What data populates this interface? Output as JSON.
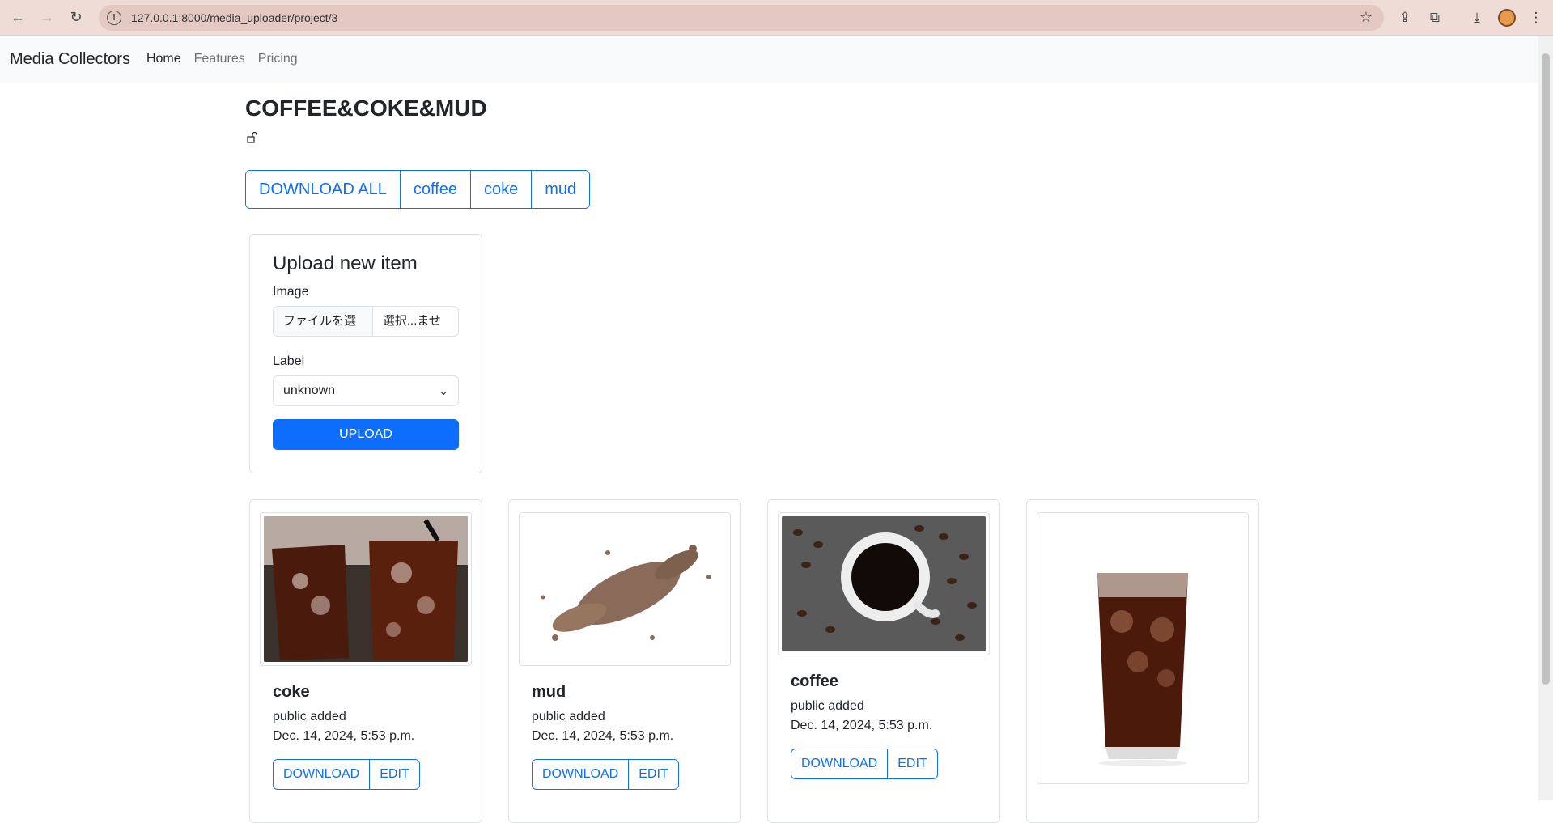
{
  "browser": {
    "url": "127.0.0.1:8000/media_uploader/project/3"
  },
  "navbar": {
    "brand": "Media Collectors",
    "links": [
      "Home",
      "Features",
      "Pricing"
    ]
  },
  "project": {
    "title": "COFFEE&COKE&MUD",
    "filters": [
      "DOWNLOAD ALL",
      "coffee",
      "coke",
      "mud"
    ]
  },
  "upload": {
    "title": "Upload new item",
    "image_label": "Image",
    "file_button": "ファイルを選択",
    "file_status": "選択...ません",
    "label_label": "Label",
    "label_value": "unknown",
    "submit": "UPLOAD"
  },
  "items": [
    {
      "title": "coke",
      "visibility": "public added",
      "date": "Dec. 14, 2024, 5:53 p.m.",
      "download": "DOWNLOAD",
      "edit": "EDIT"
    },
    {
      "title": "mud",
      "visibility": "public added",
      "date": "Dec. 14, 2024, 5:53 p.m.",
      "download": "DOWNLOAD",
      "edit": "EDIT"
    },
    {
      "title": "coffee",
      "visibility": "public added",
      "date": "Dec. 14, 2024, 5:53 p.m.",
      "download": "DOWNLOAD",
      "edit": "EDIT"
    }
  ]
}
